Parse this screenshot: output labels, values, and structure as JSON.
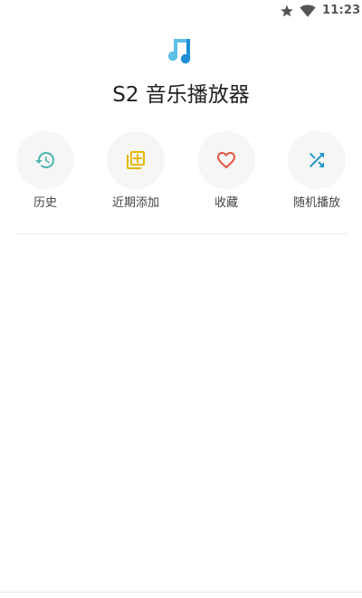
{
  "status_bar": {
    "time": "11:23",
    "icons": [
      "star-icon",
      "wifi-icon"
    ]
  },
  "app": {
    "logo_icon": "music-note-icon",
    "title": "S2 音乐播放器"
  },
  "quick_actions": [
    {
      "label": "历史",
      "icon": "history-icon",
      "color": "#4db6ac"
    },
    {
      "label": "近期添加",
      "icon": "playlist-add-icon",
      "color": "#e5b800"
    },
    {
      "label": "收藏",
      "icon": "heart-icon",
      "color": "#e5533d"
    },
    {
      "label": "随机播放",
      "icon": "shuffle-icon",
      "color": "#2196c9"
    }
  ],
  "colors": {
    "background": "#ffffff",
    "circle_bg": "#f6f6f6",
    "title_text": "#222222",
    "logo_light": "#5cc0e8",
    "logo_dark": "#1f8fd6"
  }
}
